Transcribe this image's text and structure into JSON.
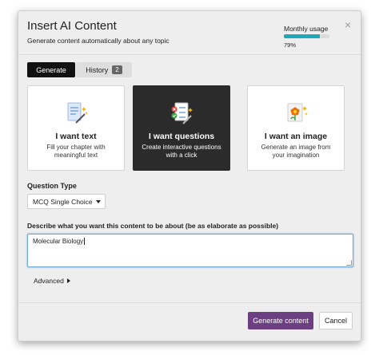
{
  "dialog": {
    "title": "Insert AI Content",
    "subtitle": "Generate content automatically about any topic",
    "close_glyph": "×"
  },
  "usage": {
    "label": "Monthly usage",
    "percent_text": "79%",
    "percent": 79,
    "color": "#1ba9bb"
  },
  "tabs": [
    {
      "label": "Generate",
      "active": true
    },
    {
      "label": "History",
      "badge": "2",
      "active": false
    }
  ],
  "cards": [
    {
      "title": "I want text",
      "description": "Fill your chapter with meaningful text",
      "icon": "text-document-icon",
      "active": false
    },
    {
      "title": "I want questions",
      "description": "Create interactive questions with a click",
      "icon": "questions-checklist-icon",
      "active": true
    },
    {
      "title": "I want an image",
      "description": "Generate an image from your imagination",
      "icon": "image-flower-icon",
      "active": false
    }
  ],
  "question_type": {
    "label": "Question Type",
    "selected": "MCQ Single Choice"
  },
  "description": {
    "label": "Describe what you want this content to be about (be as elaborate as possible)",
    "value": "Molecular Biology"
  },
  "advanced_label": "Advanced",
  "footer": {
    "generate_label": "Generate content",
    "cancel_label": "Cancel",
    "generate_color": "#6b3f82"
  }
}
